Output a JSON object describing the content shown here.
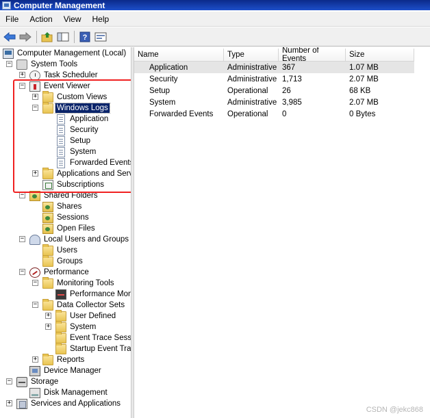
{
  "window": {
    "title": "Computer Management"
  },
  "menu": [
    "File",
    "Action",
    "View",
    "Help"
  ],
  "toolbar": {
    "icons": [
      "back-arrow-icon",
      "forward-arrow-icon",
      "up-folder-icon",
      "show-hide-tree-icon",
      "help-icon",
      "properties-icon"
    ]
  },
  "tree": {
    "root": "Computer Management (Local)",
    "system_tools": "System Tools",
    "task_scheduler": "Task Scheduler",
    "event_viewer": "Event Viewer",
    "custom_views": "Custom Views",
    "windows_logs": "Windows Logs",
    "log_application": "Application",
    "log_security": "Security",
    "log_setup": "Setup",
    "log_system": "System",
    "log_forwarded": "Forwarded Events",
    "apps_services": "Applications and Servi",
    "subscriptions": "Subscriptions",
    "shared_folders": "Shared Folders",
    "shares": "Shares",
    "sessions": "Sessions",
    "open_files": "Open Files",
    "local_users": "Local Users and Groups",
    "users": "Users",
    "groups": "Groups",
    "performance": "Performance",
    "monitoring_tools": "Monitoring Tools",
    "performance_monitor": "Performance Moni",
    "data_collector_sets": "Data Collector Sets",
    "user_defined": "User Defined",
    "dc_system": "System",
    "event_trace_sessions": "Event Trace Sessi",
    "startup_event_trace": "Startup Event Tra",
    "reports": "Reports",
    "device_manager": "Device Manager",
    "storage": "Storage",
    "disk_management": "Disk Management",
    "services_apps": "Services and Applications"
  },
  "list": {
    "columns": [
      "Name",
      "Type",
      "Number of Events",
      "Size"
    ],
    "rows": [
      {
        "name": "Application",
        "type": "Administrative",
        "events": "367",
        "size": "1.07 MB"
      },
      {
        "name": "Security",
        "type": "Administrative",
        "events": "1,713",
        "size": "2.07 MB"
      },
      {
        "name": "Setup",
        "type": "Operational",
        "events": "26",
        "size": "68 KB"
      },
      {
        "name": "System",
        "type": "Administrative",
        "events": "3,985",
        "size": "2.07 MB"
      },
      {
        "name": "Forwarded Events",
        "type": "Operational",
        "events": "0",
        "size": "0 Bytes"
      }
    ]
  },
  "watermark": "CSDN @jekc868",
  "colors": {
    "titlebar": "#1d4fc9",
    "selection": "#0a246a",
    "annotation": "#f02020"
  }
}
